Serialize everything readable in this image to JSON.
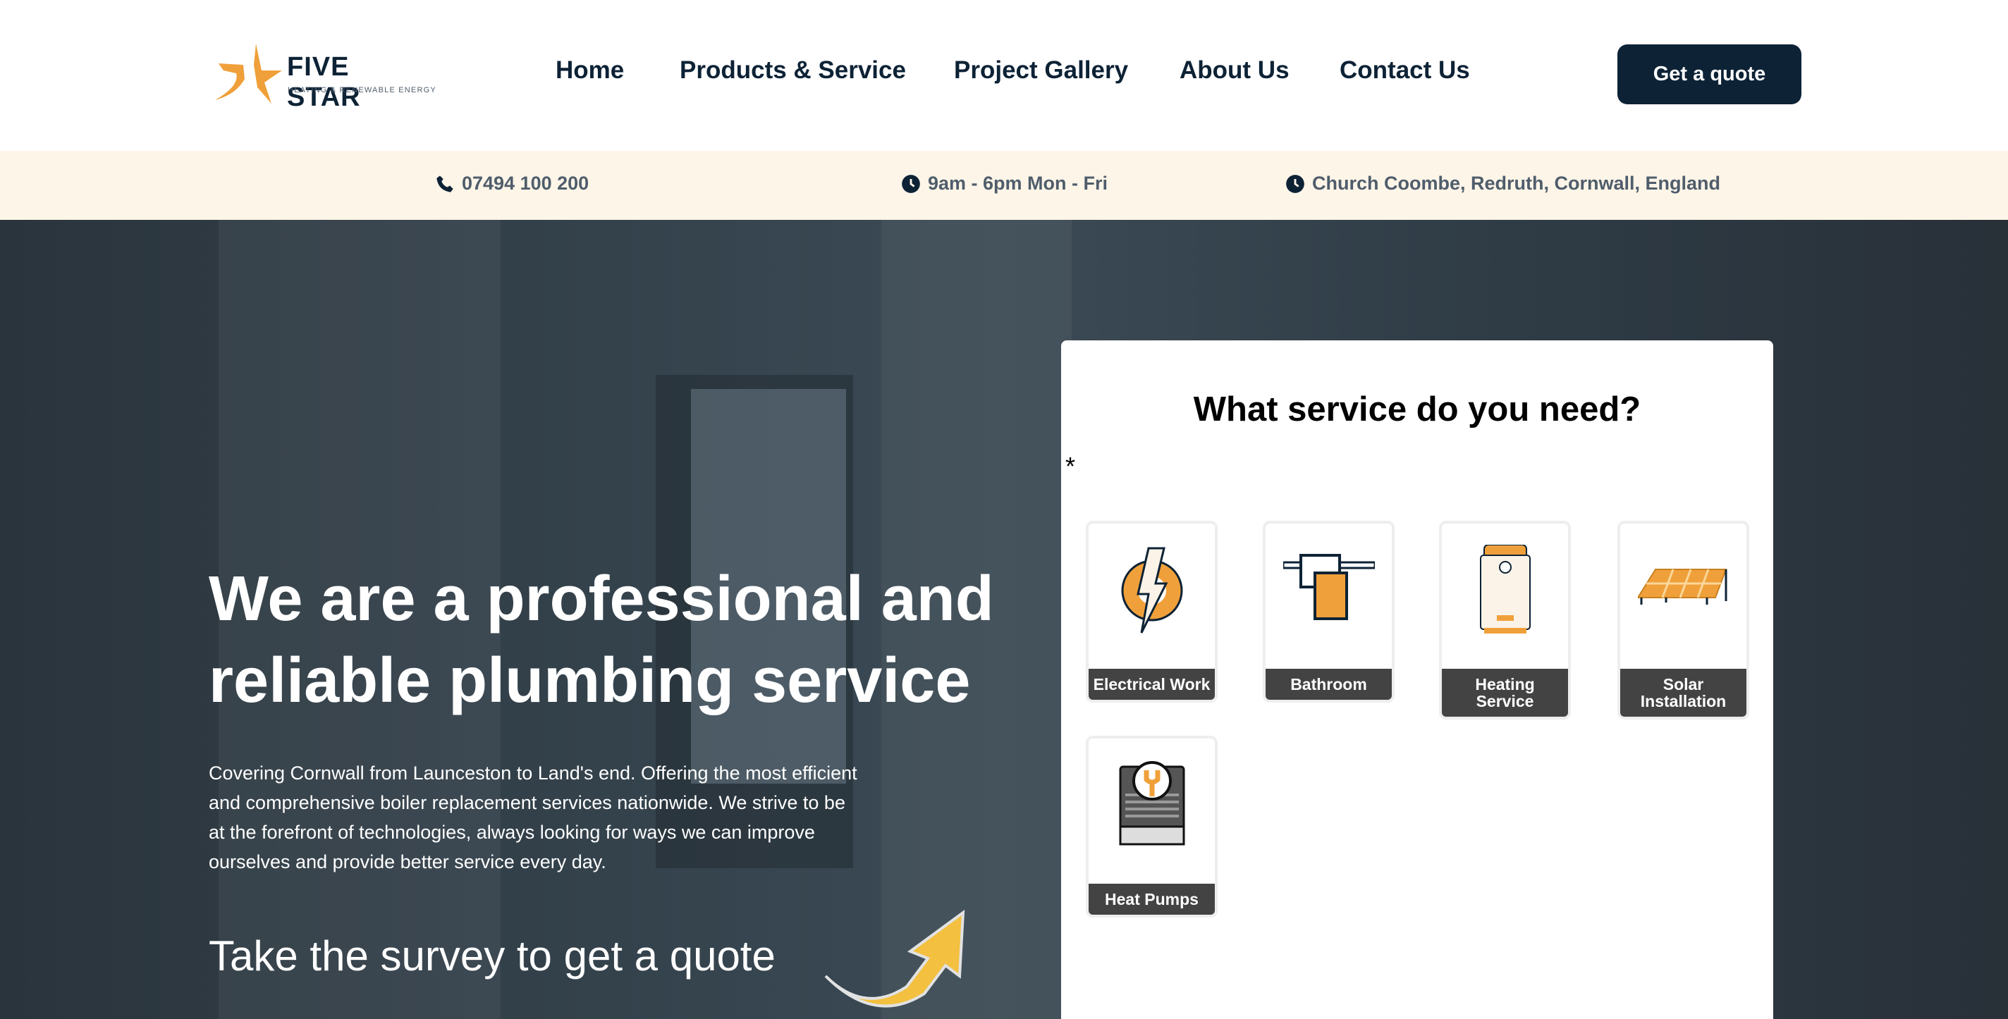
{
  "header": {
    "logo_name": "FIVE STAR",
    "logo_tagline": "HEATING & RENEWABLE ENERGY",
    "nav": [
      "Home",
      "Products & Service",
      "Project Gallery",
      "About Us",
      "Contact Us"
    ],
    "cta": "Get a quote"
  },
  "infobar": {
    "phone": "07494 100 200",
    "hours": "9am - 6pm Mon - Fri",
    "address": "Church Coombe, Redruth, Cornwall, England"
  },
  "hero": {
    "headline": "We are a professional and reliable plumbing service",
    "description": "Covering Cornwall from Launceston to Land's end. Offering the most efficient and comprehensive boiler replacement services nationwide. We strive to be at the forefront of technologies, always looking for ways we can improve ourselves and provide better service every day.",
    "survey": "Take the survey to get a quote"
  },
  "form": {
    "title": "What service do you need?",
    "required_mark": "*",
    "options": [
      {
        "label": "Electrical Work",
        "icon": "electrical-gear-icon"
      },
      {
        "label": "Bathroom",
        "icon": "towel-rail-icon"
      },
      {
        "label": "Heating Service",
        "icon": "boiler-icon"
      },
      {
        "label": "Solar Installation",
        "icon": "solar-panel-icon"
      },
      {
        "label": "Heat Pumps",
        "icon": "heat-pump-icon"
      }
    ]
  },
  "colors": {
    "navy": "#0d2235",
    "orange": "#f0a03a",
    "cream": "#fdf5e8"
  }
}
